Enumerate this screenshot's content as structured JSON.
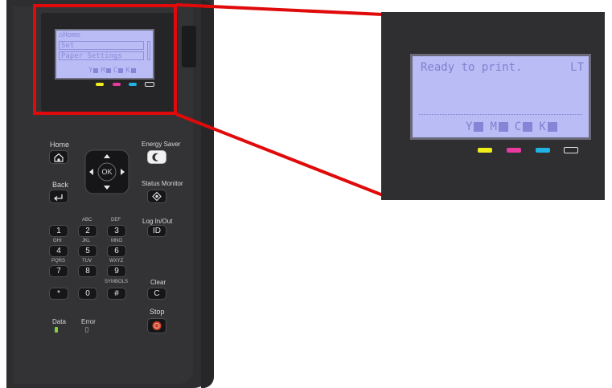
{
  "small_lcd": {
    "title": "⌂Home",
    "items": [
      "Set",
      "Paper Settings"
    ],
    "ink_letters": [
      "Y",
      "M",
      "C",
      "K"
    ]
  },
  "big_lcd": {
    "status": "Ready to print.",
    "paper": "LT",
    "ink_letters": [
      "Y",
      "M",
      "C",
      "K"
    ]
  },
  "ink_colors": {
    "yellow": "#f0ee1a",
    "magenta": "#e83a9f",
    "cyan": "#1fb3e6",
    "black": "#2a2a2a"
  },
  "highlight_color": "#e00a0a",
  "labels": {
    "home": "Home",
    "back": "Back",
    "energy_saver": "Energy Saver",
    "status_monitor": "Status Monitor",
    "log_in_out": "Log In/Out",
    "clear": "Clear",
    "stop": "Stop",
    "data": "Data",
    "error": "Error",
    "ok": "OK",
    "id": "ID",
    "c": "C"
  },
  "keypad": {
    "letters": [
      "ABC",
      "DEF",
      "GHI",
      "JKL",
      "MNO",
      "PQRS",
      "TUV",
      "WXYZ",
      "SYMBOLS"
    ],
    "keys": [
      "1",
      "2",
      "3",
      "4",
      "5",
      "6",
      "7",
      "8",
      "9",
      "*",
      "0",
      "#"
    ]
  }
}
